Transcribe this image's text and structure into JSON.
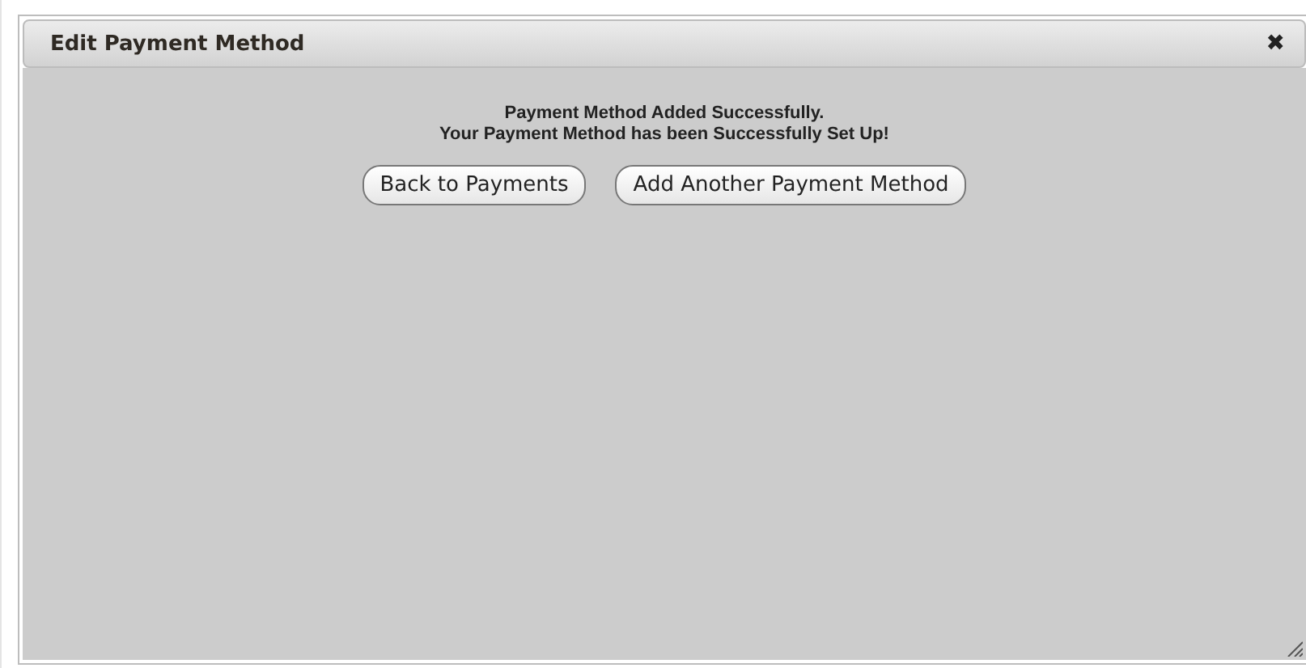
{
  "dialog": {
    "title": "Edit Payment Method",
    "close": "✖"
  },
  "message": [
    "Payment Method Added Successfully.",
    "Your Payment Method has been Successfully Set Up!"
  ],
  "buttons": [
    "Back to Payments",
    "Add Another Payment Method"
  ]
}
